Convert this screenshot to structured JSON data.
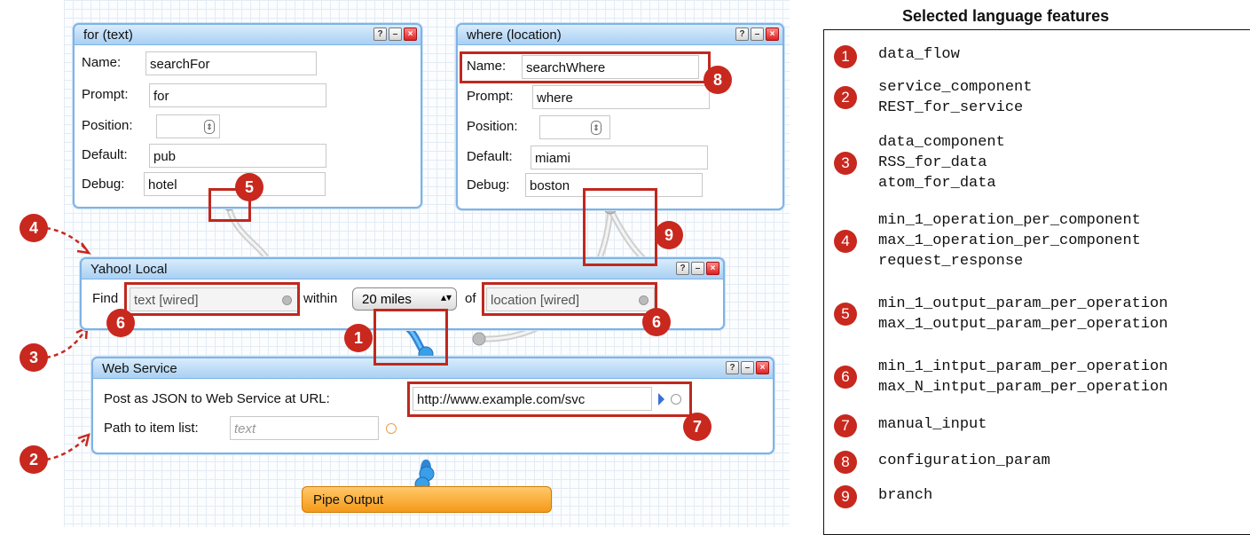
{
  "modules": {
    "for_text": {
      "title": "for (text)",
      "name_label": "Name:",
      "name_value": "searchFor",
      "prompt_label": "Prompt:",
      "prompt_value": "for",
      "position_label": "Position:",
      "default_label": "Default:",
      "default_value": "pub",
      "debug_label": "Debug:",
      "debug_value": "hotel"
    },
    "where_location": {
      "title": "where (location)",
      "name_label": "Name:",
      "name_value": "searchWhere",
      "prompt_label": "Prompt:",
      "prompt_value": "where",
      "position_label": "Position:",
      "default_label": "Default:",
      "default_value": "miami",
      "debug_label": "Debug:",
      "debug_value": "boston"
    },
    "yahoo_local": {
      "title": "Yahoo! Local",
      "find_label": "Find",
      "find_value": "text [wired]",
      "within_label": "within",
      "distance_value": "20 miles",
      "of_label": "of",
      "location_value": "location [wired]"
    },
    "web_service": {
      "title": "Web Service",
      "url_label": "Post as JSON to Web Service at URL:",
      "url_value": "http://www.example.com/svc",
      "path_label": "Path to item list:",
      "path_placeholder": "text"
    },
    "pipe_output": {
      "title": "Pipe Output"
    },
    "window_buttons": {
      "help": "?",
      "minimize": "–",
      "close": "×"
    }
  },
  "markers": [
    "1",
    "2",
    "3",
    "4",
    "5",
    "6",
    "6",
    "7",
    "8",
    "9"
  ],
  "features_panel": {
    "title": "Selected language features",
    "items": [
      {
        "num": "1",
        "text": "data_flow"
      },
      {
        "num": "2",
        "text": "service_component\nREST_for_service"
      },
      {
        "num": "3",
        "text": "data_component\nRSS_for_data\natom_for_data"
      },
      {
        "num": "4",
        "text": "min_1_operation_per_component\nmax_1_operation_per_component\nrequest_response"
      },
      {
        "num": "5",
        "text": "min_1_output_param_per_operation\nmax_1_output_param_per_operation"
      },
      {
        "num": "6",
        "text": "min_1_intput_param_per_operation\nmax_N_intput_param_per_operation"
      },
      {
        "num": "7",
        "text": "manual_input"
      },
      {
        "num": "8",
        "text": "configuration_param"
      },
      {
        "num": "9",
        "text": "branch"
      }
    ]
  },
  "colors": {
    "marker_red": "#c8281e",
    "module_border": "#7fb3e6",
    "pipe_orange": "#f59a18",
    "wire_blue": "#3a9ee8"
  }
}
